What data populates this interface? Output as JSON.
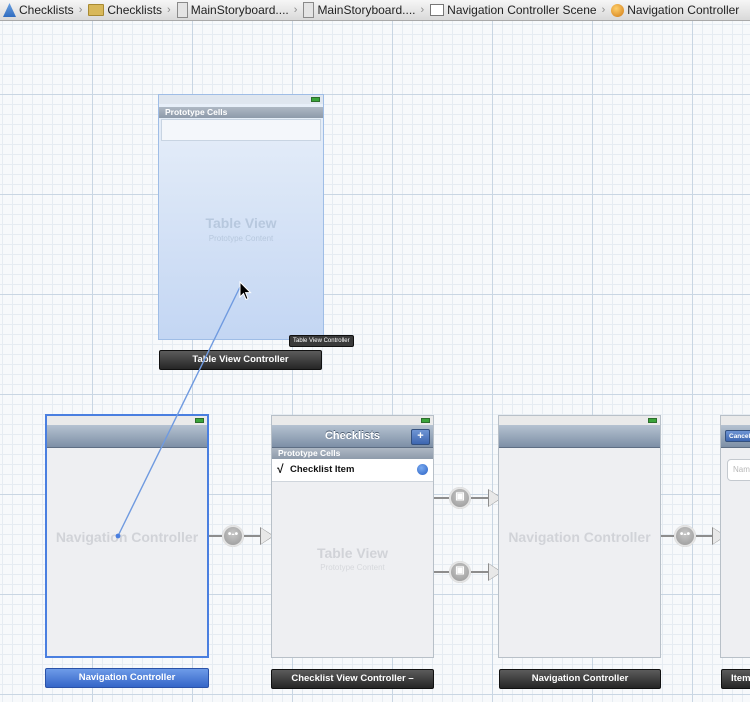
{
  "jumpbar": {
    "crumbs": [
      "Checklists",
      "Checklists",
      "MainStoryboard....",
      "MainStoryboard....",
      "Navigation Controller Scene",
      "Navigation Controller"
    ]
  },
  "table_vc": {
    "section_header": "Prototype Cells",
    "watermark": "Table View",
    "watermark_sub": "Prototype Content",
    "tooltip": "Table View Controller",
    "label": "Table View Controller"
  },
  "nav_vc_1": {
    "watermark": "Navigation Controller",
    "label": "Navigation Controller"
  },
  "checklist_vc": {
    "title": "Checklists",
    "add_button": "+",
    "section_header": "Prototype Cells",
    "checkmark": "√",
    "cell_label": "Checklist Item",
    "watermark": "Table View",
    "watermark_sub": "Prototype Content",
    "label": "Checklist View Controller –"
  },
  "nav_vc_2": {
    "watermark": "Navigation Controller",
    "label": "Navigation Controller"
  },
  "item_vc": {
    "cancel": "Cancel",
    "field_placeholder": "Nam",
    "label": "Item"
  },
  "colors": {
    "selection": "#4a7fe0",
    "navbar": "#8d9eb3",
    "segue": "#9a9a9a"
  }
}
